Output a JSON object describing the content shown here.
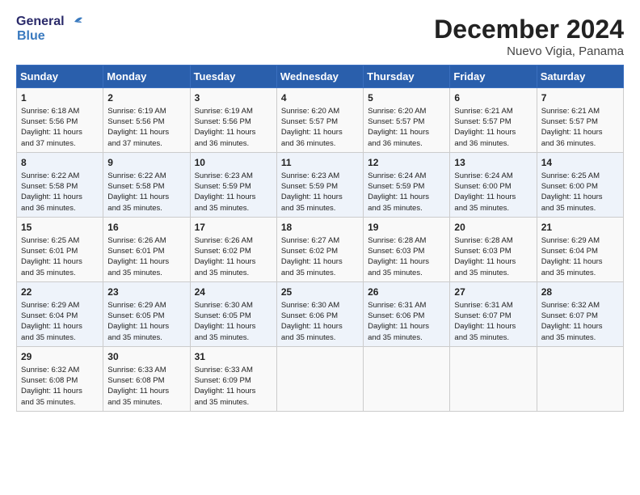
{
  "header": {
    "logo_line1": "General",
    "logo_line2": "Blue",
    "title": "December 2024",
    "subtitle": "Nuevo Vigia, Panama"
  },
  "days_of_week": [
    "Sunday",
    "Monday",
    "Tuesday",
    "Wednesday",
    "Thursday",
    "Friday",
    "Saturday"
  ],
  "weeks": [
    [
      {
        "day": "1",
        "lines": [
          "Sunrise: 6:18 AM",
          "Sunset: 5:56 PM",
          "Daylight: 11 hours",
          "and 37 minutes."
        ]
      },
      {
        "day": "2",
        "lines": [
          "Sunrise: 6:19 AM",
          "Sunset: 5:56 PM",
          "Daylight: 11 hours",
          "and 37 minutes."
        ]
      },
      {
        "day": "3",
        "lines": [
          "Sunrise: 6:19 AM",
          "Sunset: 5:56 PM",
          "Daylight: 11 hours",
          "and 36 minutes."
        ]
      },
      {
        "day": "4",
        "lines": [
          "Sunrise: 6:20 AM",
          "Sunset: 5:57 PM",
          "Daylight: 11 hours",
          "and 36 minutes."
        ]
      },
      {
        "day": "5",
        "lines": [
          "Sunrise: 6:20 AM",
          "Sunset: 5:57 PM",
          "Daylight: 11 hours",
          "and 36 minutes."
        ]
      },
      {
        "day": "6",
        "lines": [
          "Sunrise: 6:21 AM",
          "Sunset: 5:57 PM",
          "Daylight: 11 hours",
          "and 36 minutes."
        ]
      },
      {
        "day": "7",
        "lines": [
          "Sunrise: 6:21 AM",
          "Sunset: 5:57 PM",
          "Daylight: 11 hours",
          "and 36 minutes."
        ]
      }
    ],
    [
      {
        "day": "8",
        "lines": [
          "Sunrise: 6:22 AM",
          "Sunset: 5:58 PM",
          "Daylight: 11 hours",
          "and 36 minutes."
        ]
      },
      {
        "day": "9",
        "lines": [
          "Sunrise: 6:22 AM",
          "Sunset: 5:58 PM",
          "Daylight: 11 hours",
          "and 35 minutes."
        ]
      },
      {
        "day": "10",
        "lines": [
          "Sunrise: 6:23 AM",
          "Sunset: 5:59 PM",
          "Daylight: 11 hours",
          "and 35 minutes."
        ]
      },
      {
        "day": "11",
        "lines": [
          "Sunrise: 6:23 AM",
          "Sunset: 5:59 PM",
          "Daylight: 11 hours",
          "and 35 minutes."
        ]
      },
      {
        "day": "12",
        "lines": [
          "Sunrise: 6:24 AM",
          "Sunset: 5:59 PM",
          "Daylight: 11 hours",
          "and 35 minutes."
        ]
      },
      {
        "day": "13",
        "lines": [
          "Sunrise: 6:24 AM",
          "Sunset: 6:00 PM",
          "Daylight: 11 hours",
          "and 35 minutes."
        ]
      },
      {
        "day": "14",
        "lines": [
          "Sunrise: 6:25 AM",
          "Sunset: 6:00 PM",
          "Daylight: 11 hours",
          "and 35 minutes."
        ]
      }
    ],
    [
      {
        "day": "15",
        "lines": [
          "Sunrise: 6:25 AM",
          "Sunset: 6:01 PM",
          "Daylight: 11 hours",
          "and 35 minutes."
        ]
      },
      {
        "day": "16",
        "lines": [
          "Sunrise: 6:26 AM",
          "Sunset: 6:01 PM",
          "Daylight: 11 hours",
          "and 35 minutes."
        ]
      },
      {
        "day": "17",
        "lines": [
          "Sunrise: 6:26 AM",
          "Sunset: 6:02 PM",
          "Daylight: 11 hours",
          "and 35 minutes."
        ]
      },
      {
        "day": "18",
        "lines": [
          "Sunrise: 6:27 AM",
          "Sunset: 6:02 PM",
          "Daylight: 11 hours",
          "and 35 minutes."
        ]
      },
      {
        "day": "19",
        "lines": [
          "Sunrise: 6:28 AM",
          "Sunset: 6:03 PM",
          "Daylight: 11 hours",
          "and 35 minutes."
        ]
      },
      {
        "day": "20",
        "lines": [
          "Sunrise: 6:28 AM",
          "Sunset: 6:03 PM",
          "Daylight: 11 hours",
          "and 35 minutes."
        ]
      },
      {
        "day": "21",
        "lines": [
          "Sunrise: 6:29 AM",
          "Sunset: 6:04 PM",
          "Daylight: 11 hours",
          "and 35 minutes."
        ]
      }
    ],
    [
      {
        "day": "22",
        "lines": [
          "Sunrise: 6:29 AM",
          "Sunset: 6:04 PM",
          "Daylight: 11 hours",
          "and 35 minutes."
        ]
      },
      {
        "day": "23",
        "lines": [
          "Sunrise: 6:29 AM",
          "Sunset: 6:05 PM",
          "Daylight: 11 hours",
          "and 35 minutes."
        ]
      },
      {
        "day": "24",
        "lines": [
          "Sunrise: 6:30 AM",
          "Sunset: 6:05 PM",
          "Daylight: 11 hours",
          "and 35 minutes."
        ]
      },
      {
        "day": "25",
        "lines": [
          "Sunrise: 6:30 AM",
          "Sunset: 6:06 PM",
          "Daylight: 11 hours",
          "and 35 minutes."
        ]
      },
      {
        "day": "26",
        "lines": [
          "Sunrise: 6:31 AM",
          "Sunset: 6:06 PM",
          "Daylight: 11 hours",
          "and 35 minutes."
        ]
      },
      {
        "day": "27",
        "lines": [
          "Sunrise: 6:31 AM",
          "Sunset: 6:07 PM",
          "Daylight: 11 hours",
          "and 35 minutes."
        ]
      },
      {
        "day": "28",
        "lines": [
          "Sunrise: 6:32 AM",
          "Sunset: 6:07 PM",
          "Daylight: 11 hours",
          "and 35 minutes."
        ]
      }
    ],
    [
      {
        "day": "29",
        "lines": [
          "Sunrise: 6:32 AM",
          "Sunset: 6:08 PM",
          "Daylight: 11 hours",
          "and 35 minutes."
        ]
      },
      {
        "day": "30",
        "lines": [
          "Sunrise: 6:33 AM",
          "Sunset: 6:08 PM",
          "Daylight: 11 hours",
          "and 35 minutes."
        ]
      },
      {
        "day": "31",
        "lines": [
          "Sunrise: 6:33 AM",
          "Sunset: 6:09 PM",
          "Daylight: 11 hours",
          "and 35 minutes."
        ]
      },
      null,
      null,
      null,
      null
    ]
  ]
}
